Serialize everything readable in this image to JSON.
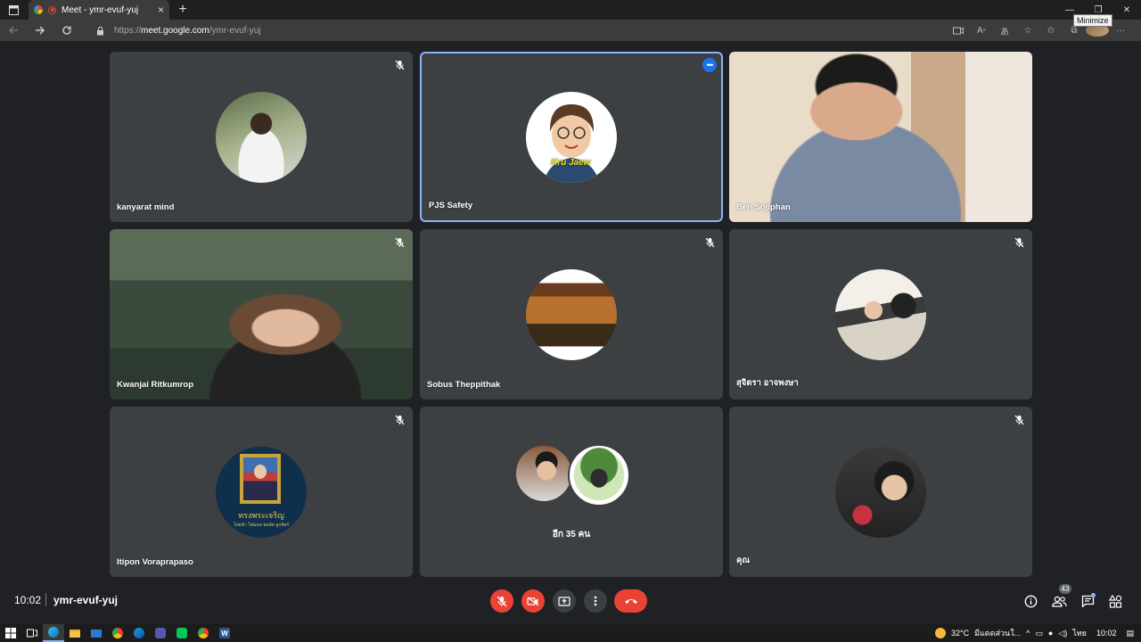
{
  "browser": {
    "tab_title": "Meet - ymr-evuf-yuj",
    "tab_close": "×",
    "new_tab": "+",
    "url_scheme": "https://",
    "url_host": "meet.google.com",
    "url_path": "/ymr-evuf-yuj",
    "tooltip": "Minimize",
    "window_controls": {
      "minimize": "—",
      "restore": "❐",
      "close": "✕"
    }
  },
  "participants": [
    {
      "name": "kanyarat mind",
      "muted": true,
      "type": "avatar"
    },
    {
      "name": "PJS Safety",
      "muted": false,
      "type": "avatar",
      "active": true,
      "avatar_text": "Kru Jaew"
    },
    {
      "name": "Ben Sojiphan",
      "muted": false,
      "type": "video"
    },
    {
      "name": "Kwanjai Ritkumrop",
      "muted": true,
      "type": "video"
    },
    {
      "name": "Sobus Theppithak",
      "muted": true,
      "type": "avatar"
    },
    {
      "name": "สุจิตรา อาจพงษา",
      "muted": true,
      "type": "avatar"
    },
    {
      "name": "Itipon Voraprapaso",
      "muted": true,
      "type": "avatar",
      "avatar_text": "ทรงพระเจริญ",
      "avatar_subtext": "โดยข้า โพ่มหล พ่อลัด ลูกจิตร์"
    },
    {
      "name": "",
      "muted": false,
      "type": "group",
      "label": "อีก 35 คน"
    },
    {
      "name": "คุณ",
      "muted": true,
      "type": "avatar"
    }
  ],
  "bottom_bar": {
    "time": "10:02",
    "meeting_code": "ymr-evuf-yuj",
    "people_count": "43"
  },
  "taskbar": {
    "weather": "32°C",
    "weather_text": "มีแดดส่วนใ...",
    "language": "ไทย",
    "time": "10:02"
  },
  "colors": {
    "background": "#202124",
    "tile": "#3c4043",
    "active_border": "#8ab4f8",
    "danger": "#ea4335",
    "accent": "#1a73e8"
  },
  "icons": [
    "mic-off-icon",
    "camera-off-icon",
    "present-icon",
    "more-vert-icon",
    "hangup-icon",
    "info-icon",
    "people-icon",
    "chat-icon",
    "activities-icon"
  ]
}
